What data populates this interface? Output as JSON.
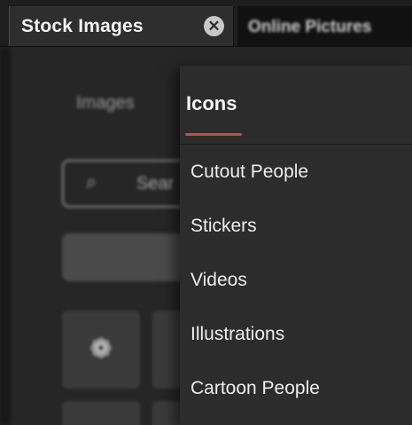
{
  "tabs": {
    "active_label": "Stock Images",
    "close_icon": "✕",
    "inactive_label": "Online Pictures"
  },
  "background": {
    "images_tab_label": "Images",
    "search_placeholder": "Sear",
    "search_icon": "⌕"
  },
  "menu": {
    "active_label": "Icons",
    "accent_color": "#c0533c",
    "items": [
      {
        "label": "Cutout People"
      },
      {
        "label": "Stickers"
      },
      {
        "label": "Videos"
      },
      {
        "label": "Illustrations"
      },
      {
        "label": "Cartoon People"
      }
    ]
  }
}
